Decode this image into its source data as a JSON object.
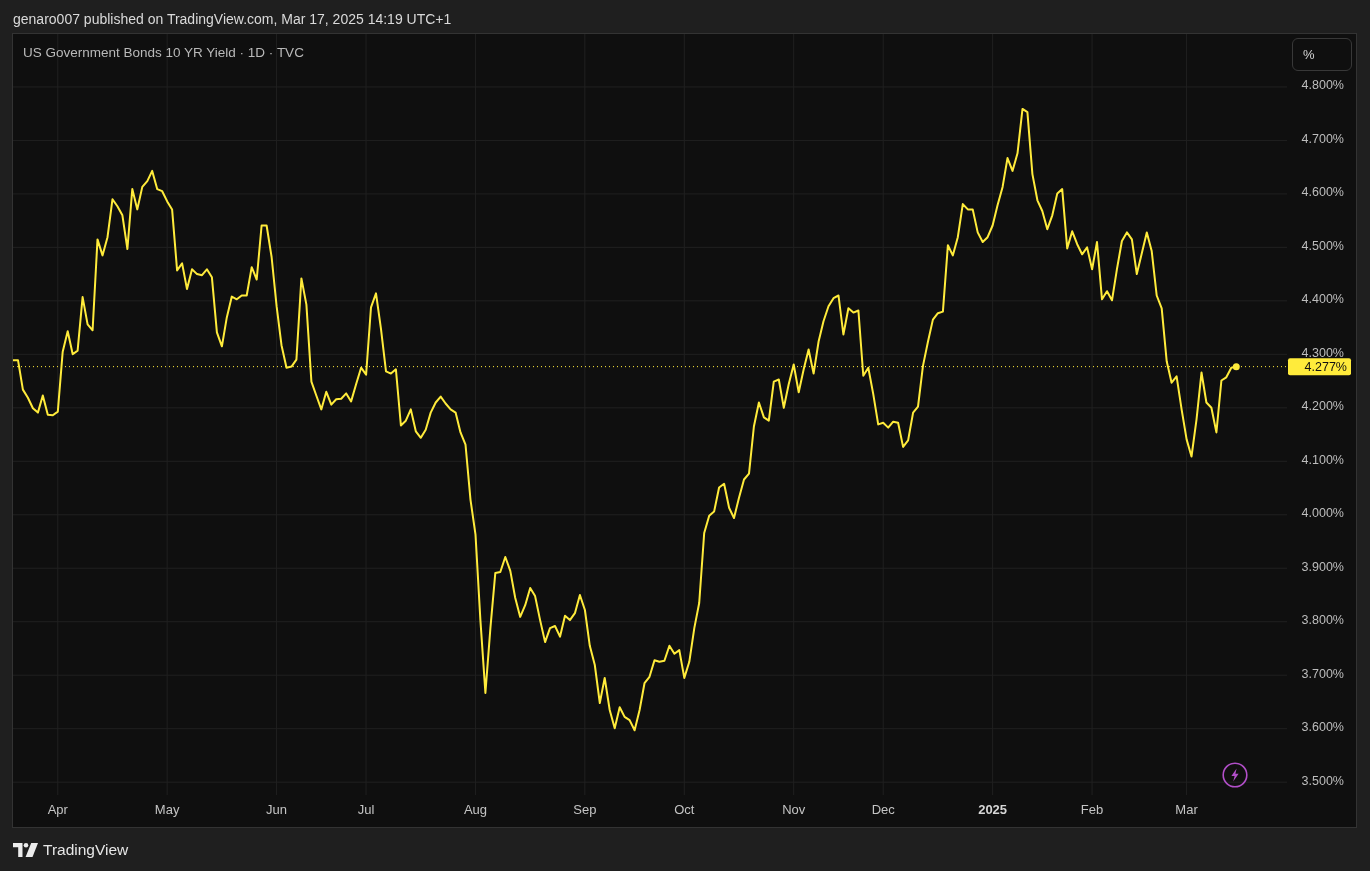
{
  "header": {
    "published_note": "genaro007 published on TradingView.com, Mar 17, 2025 14:19 UTC+1"
  },
  "chart": {
    "chart_data": {
      "type": "line",
      "title": "US Government Bonds 10 YR Yield · 1D · TVC",
      "grid": true,
      "categories": [
        null,
        null,
        null,
        null,
        null,
        null,
        null,
        null,
        null,
        "Apr",
        null,
        null,
        null,
        null,
        null,
        null,
        null,
        null,
        null,
        null,
        null,
        null,
        null,
        null,
        null,
        null,
        null,
        null,
        null,
        null,
        null,
        "May",
        null,
        null,
        null,
        null,
        null,
        null,
        null,
        null,
        null,
        null,
        null,
        null,
        null,
        null,
        null,
        null,
        null,
        null,
        null,
        null,
        null,
        "Jun",
        null,
        null,
        null,
        null,
        null,
        null,
        null,
        null,
        null,
        null,
        null,
        null,
        null,
        null,
        null,
        null,
        null,
        "Jul",
        null,
        null,
        null,
        null,
        null,
        null,
        null,
        null,
        null,
        null,
        null,
        null,
        null,
        null,
        null,
        null,
        null,
        null,
        null,
        null,
        null,
        "Aug",
        null,
        null,
        null,
        null,
        null,
        null,
        null,
        null,
        null,
        null,
        null,
        null,
        null,
        null,
        null,
        null,
        null,
        null,
        null,
        null,
        null,
        "Sep",
        null,
        null,
        null,
        null,
        null,
        null,
        null,
        null,
        null,
        null,
        null,
        null,
        null,
        null,
        null,
        null,
        null,
        null,
        null,
        "Oct",
        null,
        null,
        null,
        null,
        null,
        null,
        null,
        null,
        null,
        null,
        null,
        null,
        null,
        null,
        null,
        null,
        null,
        null,
        null,
        null,
        null,
        "Nov",
        null,
        null,
        null,
        null,
        null,
        null,
        null,
        null,
        null,
        null,
        null,
        null,
        null,
        null,
        null,
        null,
        null,
        "Dec",
        null,
        null,
        null,
        null,
        null,
        null,
        null,
        null,
        null,
        null,
        null,
        null,
        null,
        null,
        null,
        null,
        null,
        null,
        null,
        null,
        null,
        "2025",
        null,
        null,
        null,
        null,
        null,
        null,
        null,
        null,
        null,
        null,
        null,
        null,
        null,
        null,
        null,
        null,
        null,
        null,
        null,
        "Feb",
        null,
        null,
        null,
        null,
        null,
        null,
        null,
        null,
        null,
        null,
        null,
        null,
        null,
        null,
        null,
        null,
        null,
        null,
        "Mar",
        null,
        null,
        null,
        null,
        null,
        null,
        null,
        null,
        null,
        null
      ],
      "series": [
        {
          "color": "#ffeb3b",
          "values": [
            4.289,
            4.289,
            4.234,
            4.219,
            4.199,
            4.191,
            4.223,
            4.187,
            4.186,
            4.193,
            4.305,
            4.343,
            4.3,
            4.307,
            4.407,
            4.356,
            4.345,
            4.515,
            4.485,
            4.519,
            4.59,
            4.577,
            4.56,
            4.497,
            4.609,
            4.571,
            4.613,
            4.624,
            4.643,
            4.609,
            4.605,
            4.586,
            4.571,
            4.457,
            4.47,
            4.422,
            4.459,
            4.45,
            4.448,
            4.459,
            4.444,
            4.341,
            4.315,
            4.369,
            4.408,
            4.403,
            4.41,
            4.41,
            4.463,
            4.44,
            4.541,
            4.541,
            4.482,
            4.39,
            4.317,
            4.275,
            4.277,
            4.29,
            4.442,
            4.393,
            4.249,
            4.223,
            4.197,
            4.23,
            4.206,
            4.216,
            4.217,
            4.227,
            4.212,
            4.244,
            4.275,
            4.262,
            4.388,
            4.414,
            4.347,
            4.268,
            4.264,
            4.272,
            4.167,
            4.176,
            4.197,
            4.156,
            4.144,
            4.159,
            4.191,
            4.21,
            4.221,
            4.208,
            4.197,
            4.191,
            4.154,
            4.131,
            4.028,
            3.963,
            3.803,
            3.667,
            3.788,
            3.891,
            3.893,
            3.921,
            3.895,
            3.845,
            3.809,
            3.831,
            3.863,
            3.848,
            3.803,
            3.762,
            3.788,
            3.792,
            3.772,
            3.811,
            3.803,
            3.816,
            3.85,
            3.822,
            3.755,
            3.719,
            3.648,
            3.695,
            3.635,
            3.601,
            3.64,
            3.622,
            3.616,
            3.597,
            3.635,
            3.685,
            3.697,
            3.728,
            3.725,
            3.727,
            3.755,
            3.74,
            3.747,
            3.695,
            3.725,
            3.788,
            3.835,
            3.966,
            3.998,
            4.006,
            4.051,
            4.058,
            4.013,
            3.994,
            4.032,
            4.066,
            4.077,
            4.165,
            4.21,
            4.182,
            4.176,
            4.249,
            4.253,
            4.2,
            4.244,
            4.281,
            4.229,
            4.272,
            4.309,
            4.264,
            4.324,
            4.362,
            4.39,
            4.405,
            4.41,
            4.337,
            4.386,
            4.378,
            4.382,
            4.26,
            4.275,
            4.225,
            4.169,
            4.172,
            4.163,
            4.174,
            4.172,
            4.127,
            4.139,
            4.191,
            4.202,
            4.279,
            4.324,
            4.365,
            4.377,
            4.38,
            4.504,
            4.485,
            4.519,
            4.581,
            4.571,
            4.571,
            4.528,
            4.51,
            4.519,
            4.541,
            4.579,
            4.613,
            4.667,
            4.643,
            4.676,
            4.759,
            4.753,
            4.637,
            4.588,
            4.568,
            4.534,
            4.56,
            4.601,
            4.609,
            4.498,
            4.53,
            4.506,
            4.487,
            4.5,
            4.459,
            4.51,
            4.403,
            4.418,
            4.401,
            4.459,
            4.512,
            4.528,
            4.515,
            4.45,
            4.489,
            4.528,
            4.493,
            4.41,
            4.386,
            4.287,
            4.247,
            4.259,
            4.197,
            4.141,
            4.109,
            4.178,
            4.266,
            4.21,
            4.2,
            4.154,
            4.251,
            4.257,
            4.275,
            4.277
          ]
        }
      ],
      "ylim": [
        3.476,
        4.899
      ],
      "yticks": [
        {
          "value": 4.8,
          "label": "4.800%"
        },
        {
          "value": 4.7,
          "label": "4.700%"
        },
        {
          "value": 4.6,
          "label": "4.600%"
        },
        {
          "value": 4.5,
          "label": "4.500%"
        },
        {
          "value": 4.4,
          "label": "4.400%"
        },
        {
          "value": 4.3,
          "label": "4.300%"
        },
        {
          "value": 4.2,
          "label": "4.200%"
        },
        {
          "value": 4.1,
          "label": "4.100%"
        },
        {
          "value": 4.0,
          "label": "4.000%"
        },
        {
          "value": 3.9,
          "label": "3.900%"
        },
        {
          "value": 3.8,
          "label": "3.800%"
        },
        {
          "value": 3.7,
          "label": "3.700%"
        },
        {
          "value": 3.6,
          "label": "3.600%"
        },
        {
          "value": 3.5,
          "label": "3.500%"
        }
      ],
      "ref_lines": [
        {
          "axis": "y",
          "value": 4.277,
          "label": "4.277%",
          "color": "#ffeb3b"
        }
      ]
    },
    "time_axis_bold": [
      false,
      false,
      false,
      false,
      false,
      false,
      false,
      false,
      false,
      true,
      false,
      false
    ],
    "scale_button": "%"
  },
  "footer": {
    "brand": "TradingView"
  }
}
